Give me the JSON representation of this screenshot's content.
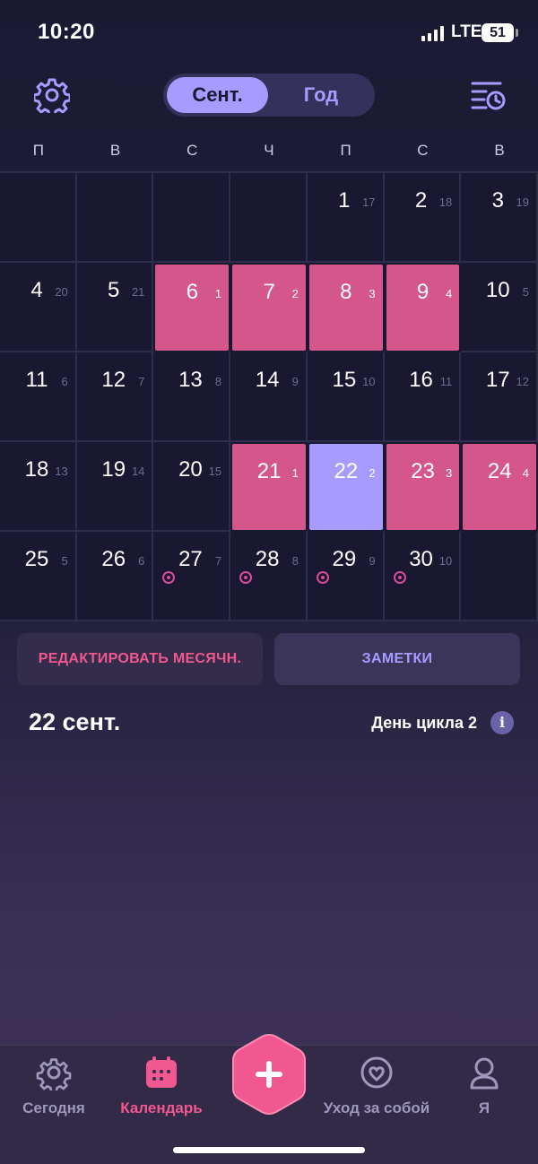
{
  "status_bar": {
    "time": "10:20",
    "network": "LTE",
    "battery": "51"
  },
  "header": {
    "segment_active": "Сент.",
    "segment_inactive": "Год"
  },
  "weekdays": [
    "П",
    "В",
    "С",
    "Ч",
    "П",
    "С",
    "В"
  ],
  "calendar": {
    "cells": [
      {
        "n": "",
        "s": ""
      },
      {
        "n": "",
        "s": ""
      },
      {
        "n": "",
        "s": ""
      },
      {
        "n": "",
        "s": ""
      },
      {
        "n": "1",
        "s": "17"
      },
      {
        "n": "2",
        "s": "18"
      },
      {
        "n": "3",
        "s": "19"
      },
      {
        "n": "4",
        "s": "20"
      },
      {
        "n": "5",
        "s": "21"
      },
      {
        "n": "6",
        "s": "1",
        "t": "period"
      },
      {
        "n": "7",
        "s": "2",
        "t": "period"
      },
      {
        "n": "8",
        "s": "3",
        "t": "period"
      },
      {
        "n": "9",
        "s": "4",
        "t": "period"
      },
      {
        "n": "10",
        "s": "5"
      },
      {
        "n": "11",
        "s": "6"
      },
      {
        "n": "12",
        "s": "7"
      },
      {
        "n": "13",
        "s": "8"
      },
      {
        "n": "14",
        "s": "9"
      },
      {
        "n": "15",
        "s": "10"
      },
      {
        "n": "16",
        "s": "11"
      },
      {
        "n": "17",
        "s": "12"
      },
      {
        "n": "18",
        "s": "13"
      },
      {
        "n": "19",
        "s": "14"
      },
      {
        "n": "20",
        "s": "15"
      },
      {
        "n": "21",
        "s": "1",
        "t": "period"
      },
      {
        "n": "22",
        "s": "2",
        "t": "today"
      },
      {
        "n": "23",
        "s": "3",
        "t": "period"
      },
      {
        "n": "24",
        "s": "4",
        "t": "period"
      },
      {
        "n": "25",
        "s": "5"
      },
      {
        "n": "26",
        "s": "6"
      },
      {
        "n": "27",
        "s": "7",
        "o": true
      },
      {
        "n": "28",
        "s": "8",
        "o": true
      },
      {
        "n": "29",
        "s": "9",
        "o": true
      },
      {
        "n": "30",
        "s": "10",
        "o": true
      },
      {
        "n": "",
        "s": ""
      }
    ]
  },
  "actions": {
    "edit_label": "РЕДАКТИРОВАТЬ МЕСЯЧН.",
    "notes_label": "ЗАМЕТКИ"
  },
  "day": {
    "title": "22 сент.",
    "cycle_day": "День цикла 2",
    "info_glyph": "i"
  },
  "tabbar": {
    "today": "Сегодня",
    "calendar": "Календарь",
    "selfcare": "Уход за собой",
    "me": "Я"
  },
  "colors": {
    "accent": "#a89bff",
    "period": "#d4568a",
    "pink": "#f0588f",
    "background": "#1b1a33"
  },
  "icons": [
    "gear-icon",
    "history-icon",
    "calendar-icon",
    "plus-icon",
    "heart-circle-icon",
    "person-icon",
    "ovulation-icon",
    "info-icon"
  ]
}
